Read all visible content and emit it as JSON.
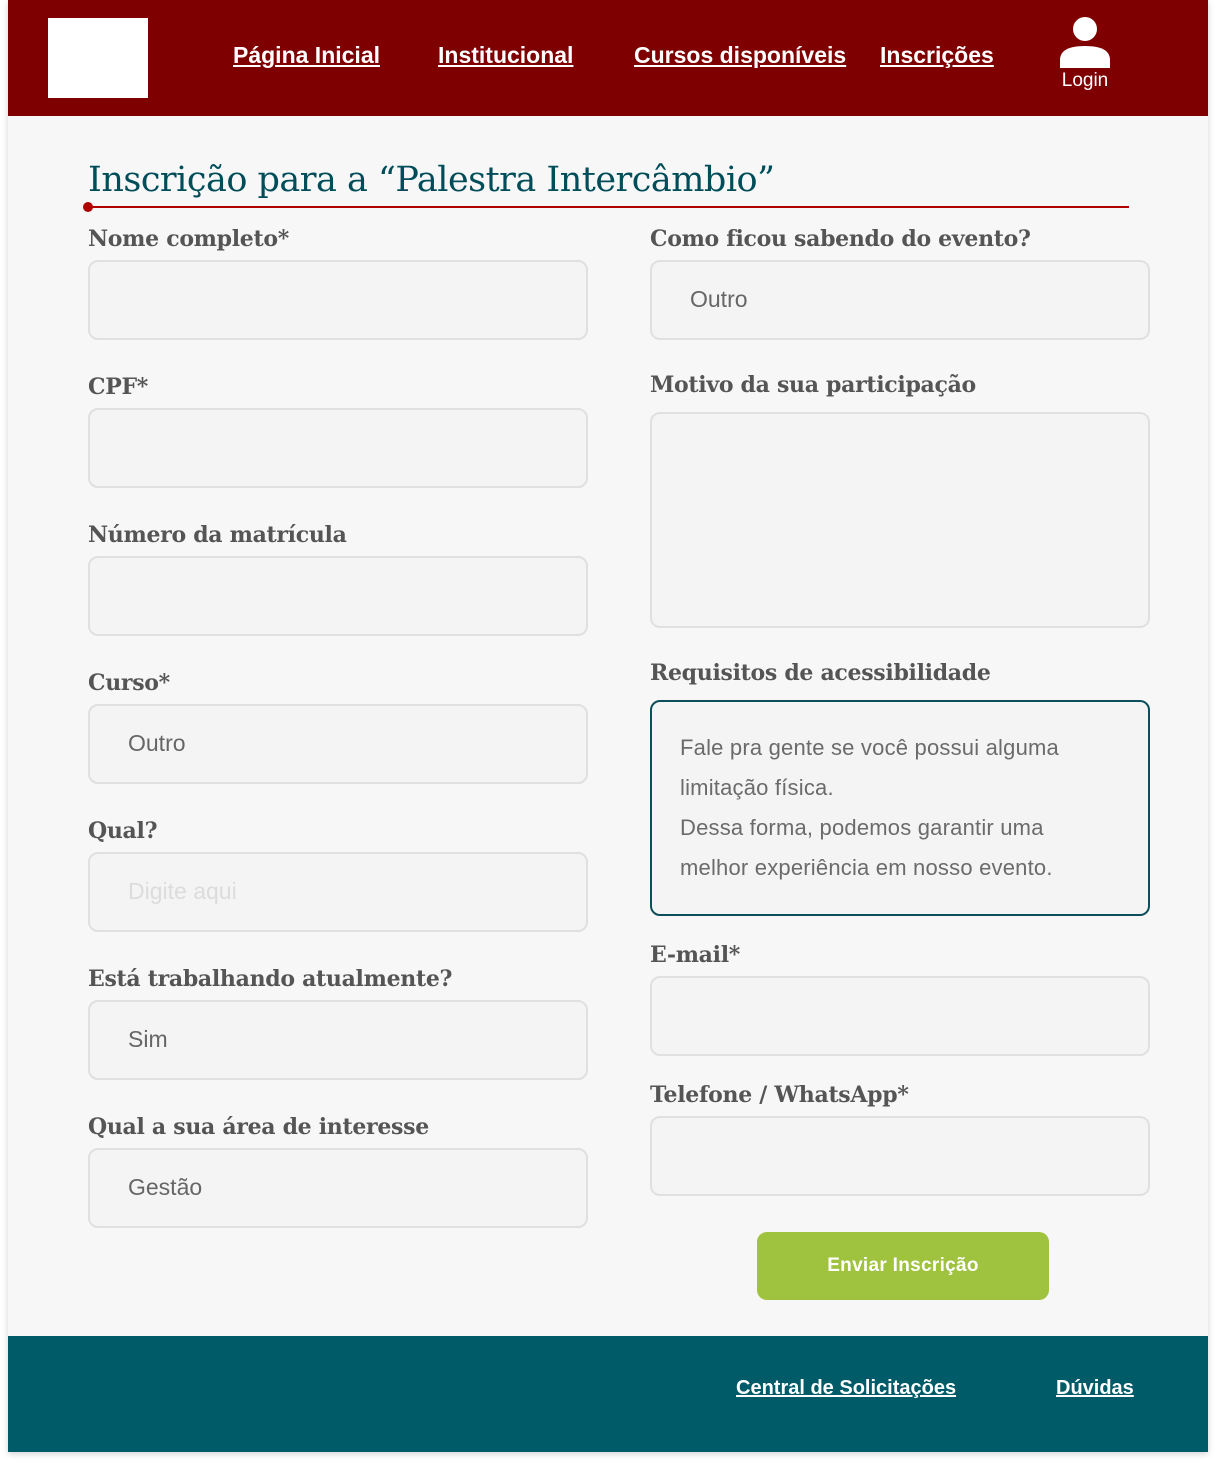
{
  "header": {
    "nav": [
      {
        "label": "Página Inicial"
      },
      {
        "label": "Institucional"
      },
      {
        "label": "Cursos disponíveis"
      },
      {
        "label": "Inscrições"
      }
    ],
    "login_label": "Login",
    "login_icon": "user-icon"
  },
  "page": {
    "title": "Inscrição para a “Palestra Intercâmbio”"
  },
  "form": {
    "nome": {
      "label": "Nome completo*",
      "value": ""
    },
    "cpf": {
      "label": "CPF*",
      "value": ""
    },
    "matricula": {
      "label": "Número da matrícula",
      "value": ""
    },
    "curso": {
      "label": "Curso*",
      "value": "Outro"
    },
    "qual": {
      "label": "Qual?",
      "placeholder": "Digite aqui"
    },
    "trabalhando": {
      "label": "Está trabalhando atualmente?",
      "value": "Sim"
    },
    "area": {
      "label": "Qual a sua área de interesse",
      "value": "Gestão"
    },
    "como_soube": {
      "label": "Como ficou sabendo do evento?",
      "value": "Outro"
    },
    "motivo": {
      "label": "Motivo da sua participação",
      "value": ""
    },
    "acessibilidade": {
      "label": "Requisitos de acessibilidade",
      "placeholder_line1": "Fale pra gente se você possui alguma",
      "placeholder_line2": "limitação física.",
      "placeholder_line3": "Dessa forma, podemos garantir uma",
      "placeholder_line4": "melhor experiência em nosso evento."
    },
    "email": {
      "label": "E-mail*",
      "value": ""
    },
    "telefone": {
      "label": "Telefone / WhatsApp*",
      "value": ""
    },
    "submit_label": "Enviar Inscrição"
  },
  "footer": {
    "links": [
      {
        "label": "Central de Solicitações"
      },
      {
        "label": "Dúvidas"
      }
    ]
  },
  "colors": {
    "header_bg": "#7f0000",
    "footer_bg": "#005b69",
    "title": "#004d5a",
    "accent_rule": "#b00000",
    "submit_bg": "#9fc23f"
  }
}
